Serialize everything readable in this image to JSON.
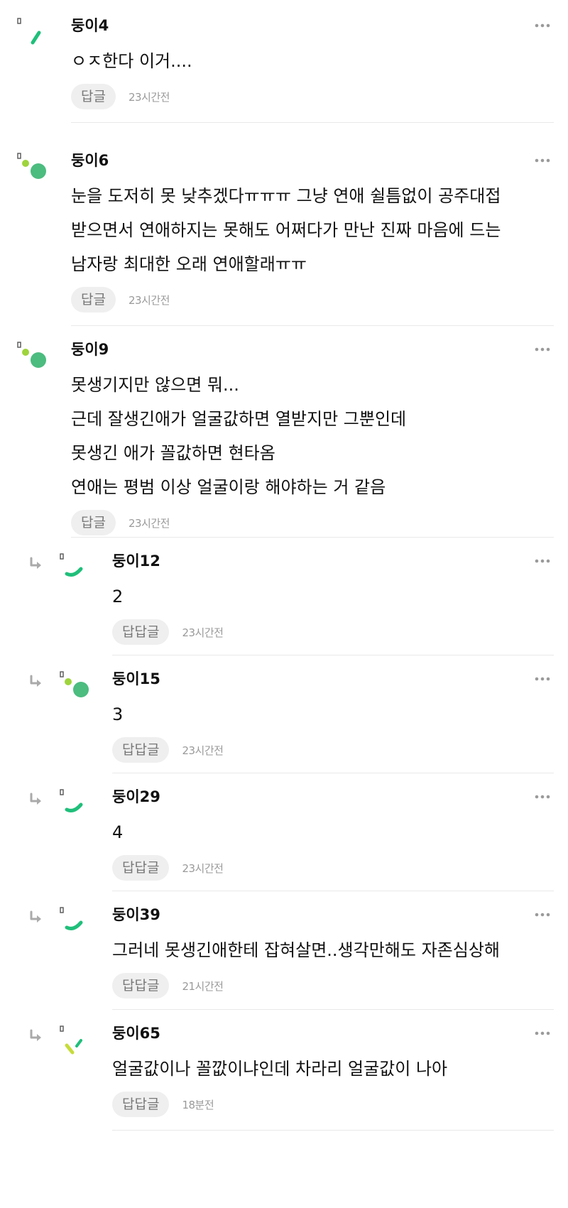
{
  "comments": [
    {
      "author": "둥이4",
      "lines": [
        "ㅇㅈ한다 이거...."
      ],
      "action_label": "답글",
      "time": "23시간전",
      "avatar": "green-slash-avatar",
      "reply": false
    },
    {
      "author": "둥이6",
      "lines": [
        "눈을 도저히 못 낮추겠다ㅠㅠㅠ 그냥 연애 쉴틈없이 공주대접",
        "받으면서 연애하지는 못해도 어쩌다가 만난 진짜 마음에 드는",
        "남자랑 최대한 오래 연애할래ㅠㅠ"
      ],
      "action_label": "답글",
      "time": "23시간전",
      "avatar": "green-dots-avatar",
      "reply": false
    },
    {
      "author": "둥이9",
      "lines": [
        "못생기지만 않으면 뭐...",
        "근데 잘생긴애가 얼굴값하면 열받지만 그뿐인데",
        "못생긴 애가 꼴값하면 현타옴",
        "연애는 평범 이상 얼굴이랑 해야하는 거 같음"
      ],
      "action_label": "답글",
      "time": "23시간전",
      "avatar": "green-dots-avatar",
      "reply": false
    },
    {
      "author": "둥이12",
      "lines": [
        "2"
      ],
      "action_label": "답답글",
      "time": "23시간전",
      "avatar": "green-arc-avatar",
      "reply": true
    },
    {
      "author": "둥이15",
      "lines": [
        "3"
      ],
      "action_label": "답답글",
      "time": "23시간전",
      "avatar": "green-dots-avatar",
      "reply": true
    },
    {
      "author": "둥이29",
      "lines": [
        "4"
      ],
      "action_label": "답답글",
      "time": "23시간전",
      "avatar": "green-arc-avatar",
      "reply": true
    },
    {
      "author": "둥이39",
      "lines": [
        "그러네 못생긴애한테 잡혀살면..생각만해도 자존심상해"
      ],
      "action_label": "답답글",
      "time": "21시간전",
      "avatar": "green-arc-avatar",
      "reply": true
    },
    {
      "author": "둥이65",
      "lines": [
        "얼굴값이나 꼴깞이냐인데 차라리 얼굴값이 나아"
      ],
      "action_label": "답답글",
      "time": "18분전",
      "avatar": "lime-lines-avatar",
      "reply": true
    }
  ],
  "colors": {
    "accent_green": "#1fbf7a",
    "dot_green": "#4cbc7f",
    "dot_lime": "#9ed43c",
    "lime": "#c6dc3a",
    "button_bg": "#efefef",
    "meta_text": "#9a9a9a",
    "divider": "#e9e9e9"
  },
  "icons": {
    "more": "more-horizontal-icon",
    "reply": "reply-arrow-icon"
  }
}
